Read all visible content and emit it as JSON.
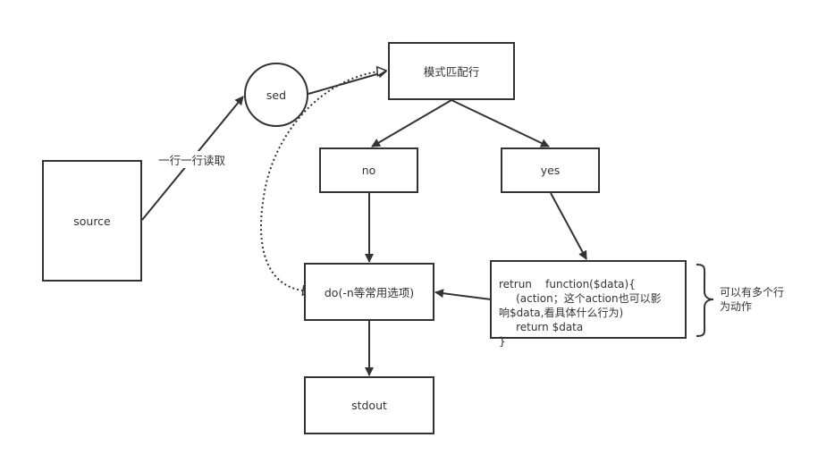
{
  "nodes": {
    "source": "source",
    "sed": "sed",
    "pattern": "模式匹配行",
    "no": "no",
    "yes": "yes",
    "do": "do(-n等常用选项)",
    "stdout": "stdout"
  },
  "edge_labels": {
    "read_line": "一行一行读取"
  },
  "code_block": {
    "lines": [
      "retrun    function($data){",
      "     (action；这个action也可以影",
      "响$data,看具体什么行为)",
      "     return $data",
      "}"
    ]
  },
  "annotation": {
    "lines": [
      "可以有多个行",
      "为动作"
    ]
  }
}
